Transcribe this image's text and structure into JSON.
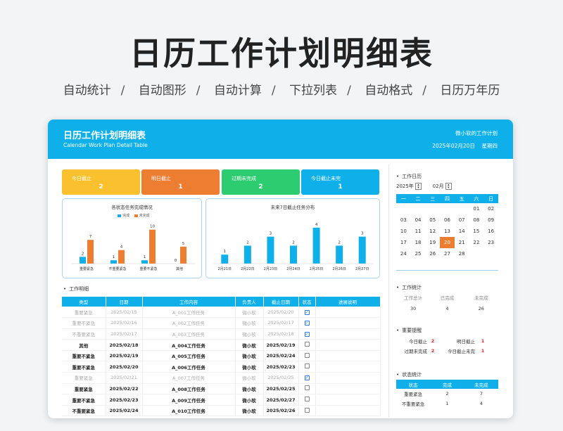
{
  "banner": {
    "title": "日历工作计划明细表",
    "features": [
      "自动统计",
      "自动图形",
      "自动计算",
      "下拉列表",
      "自动格式",
      "日历万年历"
    ]
  },
  "header": {
    "title": "日历工作计划明细表",
    "subtitle": "Calendar Work Plan Detail Table",
    "owner": "微小软的工作计划",
    "date": "2025年02月20日",
    "weekday": "星期四"
  },
  "kpis": [
    {
      "label": "今日截止",
      "value": "2",
      "color": "#fbc02d"
    },
    {
      "label": "明日截止",
      "value": "1",
      "color": "#ed7d31"
    },
    {
      "label": "过期未完成",
      "value": "2",
      "color": "#2ecc71"
    },
    {
      "label": "今日截止未完",
      "value": "1",
      "color": "#0fb0ea"
    }
  ],
  "colors": {
    "done": "#0fb0ea",
    "undone": "#ed7d31"
  },
  "chart_data": [
    {
      "type": "bar",
      "title": "各状态任务完成情况",
      "categories": [
        "重要紧急",
        "不重要紧急",
        "重要不紧急",
        "其他"
      ],
      "series": [
        {
          "name": "完成",
          "values": [
            2,
            1,
            1,
            0
          ]
        },
        {
          "name": "未完成",
          "values": [
            7,
            4,
            10,
            5
          ]
        }
      ],
      "ylim": [
        0,
        12
      ]
    },
    {
      "type": "bar",
      "title": "未来7日截止任务分布",
      "categories": [
        "2月21日",
        "2月22日",
        "2月23日",
        "2月24日",
        "2月25日",
        "2月26日",
        "2月27日"
      ],
      "values": [
        1,
        2,
        3,
        2,
        4,
        2,
        3
      ],
      "ylim": [
        0,
        5
      ]
    }
  ],
  "worklist": {
    "title": "工作明细",
    "columns": [
      "类型",
      "日期",
      "工作内容",
      "负责人",
      "截止日期",
      "状态",
      "进展说明"
    ],
    "rows": [
      {
        "type": "重要紧急",
        "date": "2025/02/15",
        "task": "A_001工作任务",
        "owner": "微小软",
        "due": "2025/02/20",
        "done": true
      },
      {
        "type": "重要不紧急",
        "date": "2025/02/16",
        "task": "A_002工作任务",
        "owner": "微小软",
        "due": "2025/02/17",
        "done": true
      },
      {
        "type": "不重要紧急",
        "date": "2025/02/17",
        "task": "A_003工作任务",
        "owner": "微小软",
        "due": "2025/02/18",
        "done": true
      },
      {
        "type": "其他",
        "date": "2025/02/18",
        "task": "A_004工作任务",
        "owner": "微小软",
        "due": "2025/02/19",
        "done": false
      },
      {
        "type": "重要不紧急",
        "date": "2025/02/19",
        "task": "A_005工作任务",
        "owner": "微小软",
        "due": "2025/02/24",
        "done": false
      },
      {
        "type": "重要不紧急",
        "date": "2025/02/20",
        "task": "A_006工作任务",
        "owner": "微小软",
        "due": "2025/02/23",
        "done": false
      },
      {
        "type": "重要紧急",
        "date": "2025/02/21",
        "task": "A_007工作任务",
        "owner": "微小软",
        "due": "2025/02/25",
        "done": true
      },
      {
        "type": "重要紧急",
        "date": "2025/02/22",
        "task": "A_008工作任务",
        "owner": "微小软",
        "due": "2025/02/25",
        "done": false
      },
      {
        "type": "重要不紧急",
        "date": "2025/02/23",
        "task": "A_009工作任务",
        "owner": "微小软",
        "due": "2025/02/27",
        "done": false
      },
      {
        "type": "不重要紧急",
        "date": "2025/02/24",
        "task": "A_010工作任务",
        "owner": "微小软",
        "due": "2025/02/26",
        "done": false
      }
    ]
  },
  "calendar": {
    "title": "工作日历",
    "year": "2025",
    "year_suffix": "年",
    "month": "02",
    "month_suffix": "月",
    "weekdays": [
      "一",
      "二",
      "三",
      "四",
      "五",
      "六",
      "日"
    ],
    "weeks": [
      [
        "",
        "",
        "",
        "",
        "",
        "01",
        "02"
      ],
      [
        "03",
        "04",
        "05",
        "06",
        "07",
        "08",
        "09"
      ],
      [
        "10",
        "11",
        "12",
        "13",
        "14",
        "15",
        "16"
      ],
      [
        "17",
        "18",
        "19",
        "20",
        "21",
        "22",
        "23"
      ],
      [
        "24",
        "25",
        "26",
        "27",
        "28",
        "",
        ""
      ]
    ],
    "today": "20"
  },
  "work_stats": {
    "title": "工作统计",
    "headers": [
      "工作总计",
      "已完成",
      "未完成"
    ],
    "values": [
      "30",
      "4",
      "26"
    ]
  },
  "reminders": {
    "title": "重要提醒",
    "items": [
      {
        "label": "今日截止",
        "value": "2"
      },
      {
        "label": "明日截止",
        "value": "1"
      },
      {
        "label": "过期未完成",
        "value": "2"
      },
      {
        "label": "今日截止未完",
        "value": "1"
      }
    ]
  },
  "status_stats": {
    "title": "状态统计",
    "columns": [
      "状态",
      "完成",
      "未完成"
    ],
    "rows": [
      {
        "status": "重要紧急",
        "done": "2",
        "undone": "7"
      },
      {
        "status": "不重要紧急",
        "done": "1",
        "undone": "4"
      }
    ]
  }
}
